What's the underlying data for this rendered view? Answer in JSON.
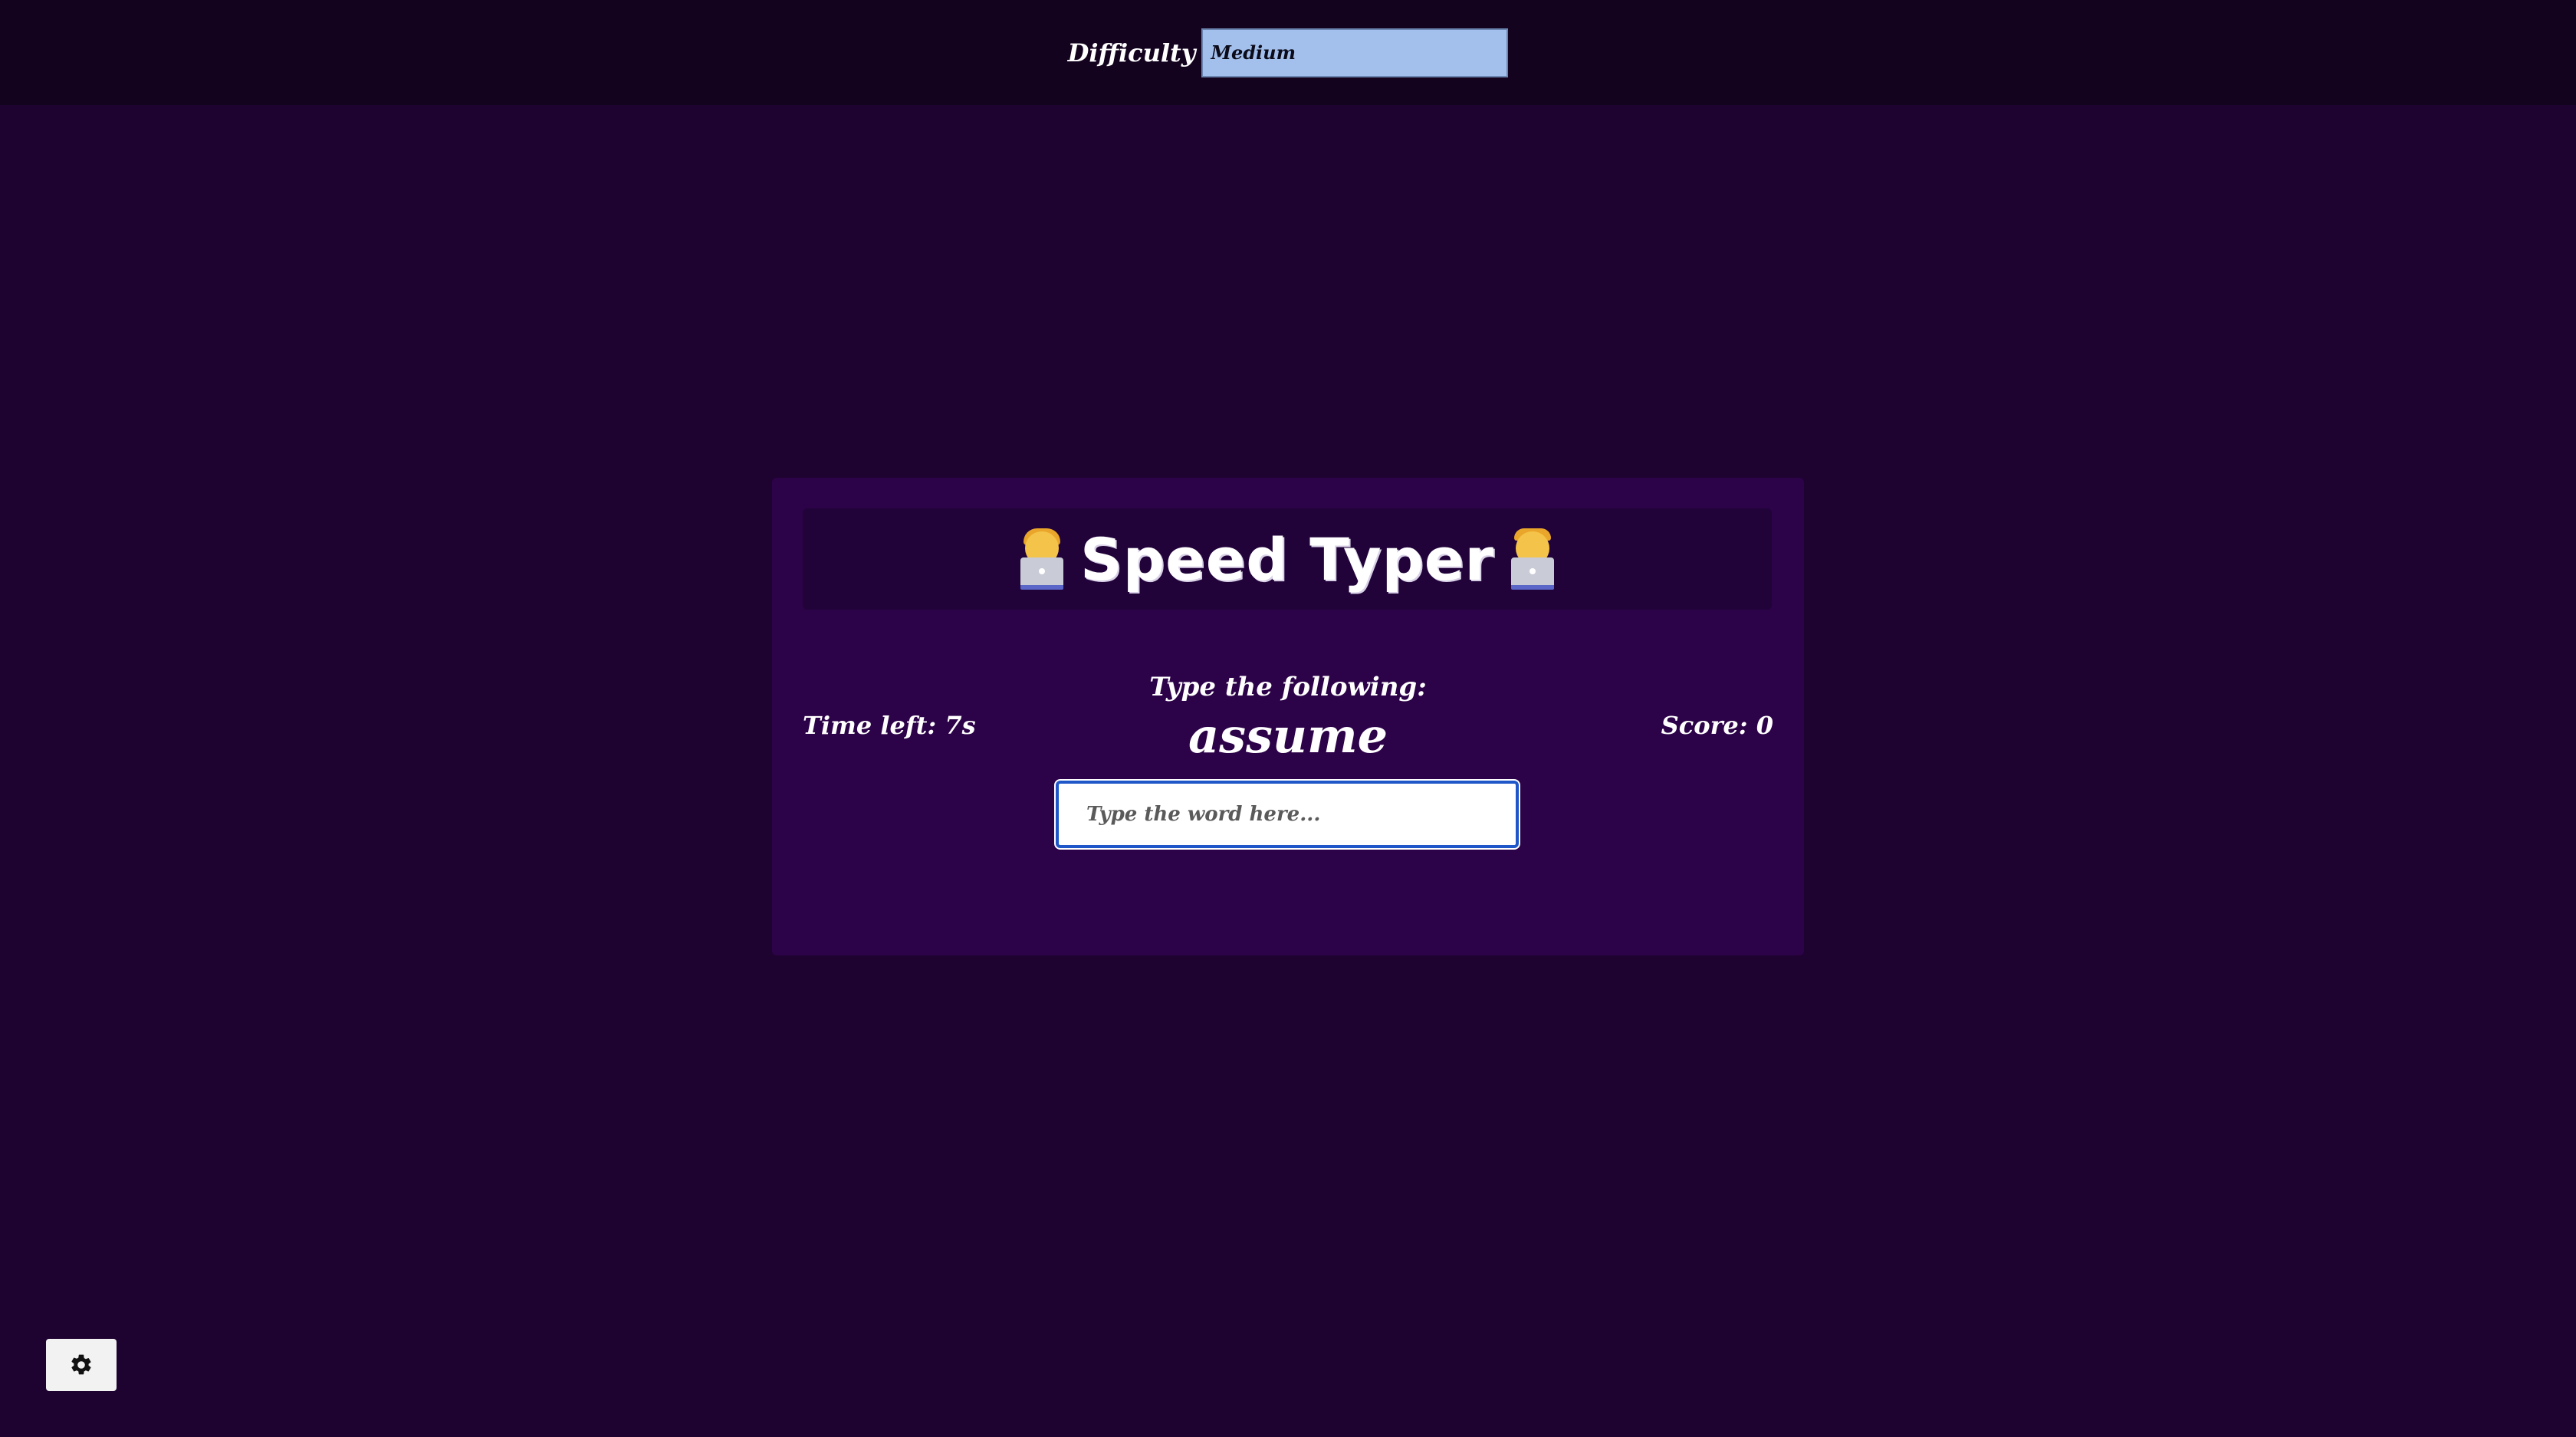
{
  "header": {
    "difficulty_label": "Difficulty",
    "difficulty_selected": "Medium"
  },
  "game": {
    "title": "Speed Typer",
    "title_left_icon": "woman-technologist-icon",
    "title_right_icon": "man-technologist-icon",
    "prompt_label": "Type the following:",
    "current_word": "assume",
    "time_left": "Time left: 7s",
    "score": "Score: 0",
    "input_placeholder": "Type the word here...",
    "input_value": ""
  },
  "settings": {
    "icon": "gear-icon"
  },
  "colors": {
    "background": "#1e0230",
    "topbar": "#14031f",
    "card": "#2c0248",
    "title_bar": "#21033a",
    "select_bg": "#a3c0ec",
    "input_border": "#1f57c8"
  }
}
